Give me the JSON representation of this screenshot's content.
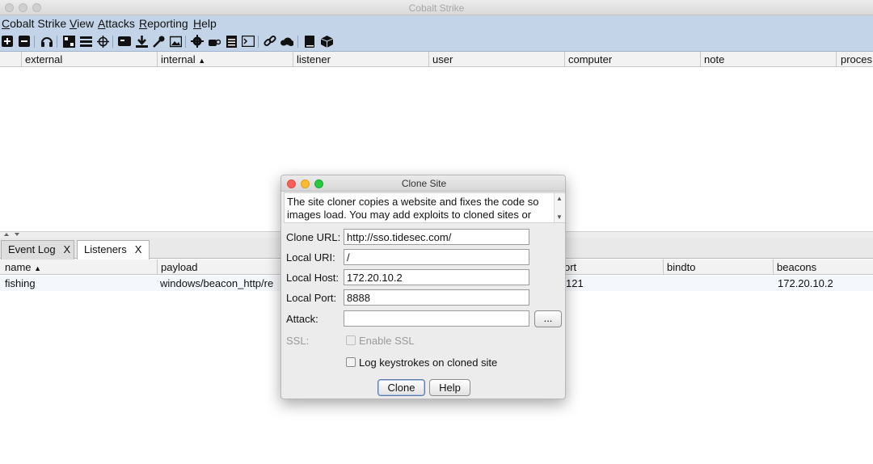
{
  "window": {
    "title": "Cobalt Strike"
  },
  "menubar": {
    "items": [
      {
        "label": "Cobalt Strike",
        "mnemonic": "C",
        "rest": "obalt Strike"
      },
      {
        "label": "View",
        "mnemonic": "V",
        "rest": "iew"
      },
      {
        "label": "Attacks",
        "mnemonic": "A",
        "rest": "ttacks"
      },
      {
        "label": "Reporting",
        "mnemonic": "R",
        "rest": "eporting"
      },
      {
        "label": "Help",
        "mnemonic": "H",
        "rest": "elp"
      }
    ]
  },
  "toolbar": {
    "icons": [
      "new-connection-icon",
      "remove-connection-icon",
      "headset-icon",
      "pivot-graph-icon",
      "session-table-icon",
      "target-crosshair-icon",
      "credentials-icon",
      "downloads-icon",
      "keys-icon",
      "screenshots-icon",
      "settings-gear-icon",
      "coffee-cup-icon",
      "document-icon",
      "console-icon",
      "link-icon",
      "cloud-icon",
      "book-icon",
      "cube-icon"
    ]
  },
  "sessions_table": {
    "columns": [
      "external",
      "internal",
      "listener",
      "user",
      "computer",
      "note",
      "proces"
    ],
    "sort_indicator": "▲"
  },
  "tabs": [
    {
      "label": "Event Log",
      "close": "X"
    },
    {
      "label": "Listeners",
      "close": "X"
    }
  ],
  "listeners_table": {
    "columns": [
      "name",
      "payload",
      "ort",
      "bindto",
      "beacons"
    ],
    "sort_indicator": "▲",
    "rows": [
      {
        "name": "fishing",
        "payload": "windows/beacon_http/re",
        "port": "121",
        "bindto": "",
        "beacons": "172.20.10.2"
      }
    ]
  },
  "dialog": {
    "title": "Clone Site",
    "description": "The site cloner copies a website and fixes the code so images load. You may add exploits to cloned sites or",
    "fields": {
      "clone_url": {
        "label": "Clone URL:",
        "value": "http://sso.tidesec.com/"
      },
      "local_uri": {
        "label": "Local URI:",
        "value": "/"
      },
      "local_host": {
        "label": "Local Host:",
        "value": "172.20.10.2"
      },
      "local_port": {
        "label": "Local Port:",
        "value": "8888"
      },
      "attack": {
        "label": "Attack:",
        "value": "",
        "browse_label": "..."
      },
      "ssl": {
        "label": "SSL:",
        "checkbox_label": "Enable SSL"
      },
      "log_keystrokes": {
        "checkbox_label": "Log keystrokes on cloned site"
      }
    },
    "buttons": {
      "clone": "Clone",
      "help": "Help"
    }
  }
}
